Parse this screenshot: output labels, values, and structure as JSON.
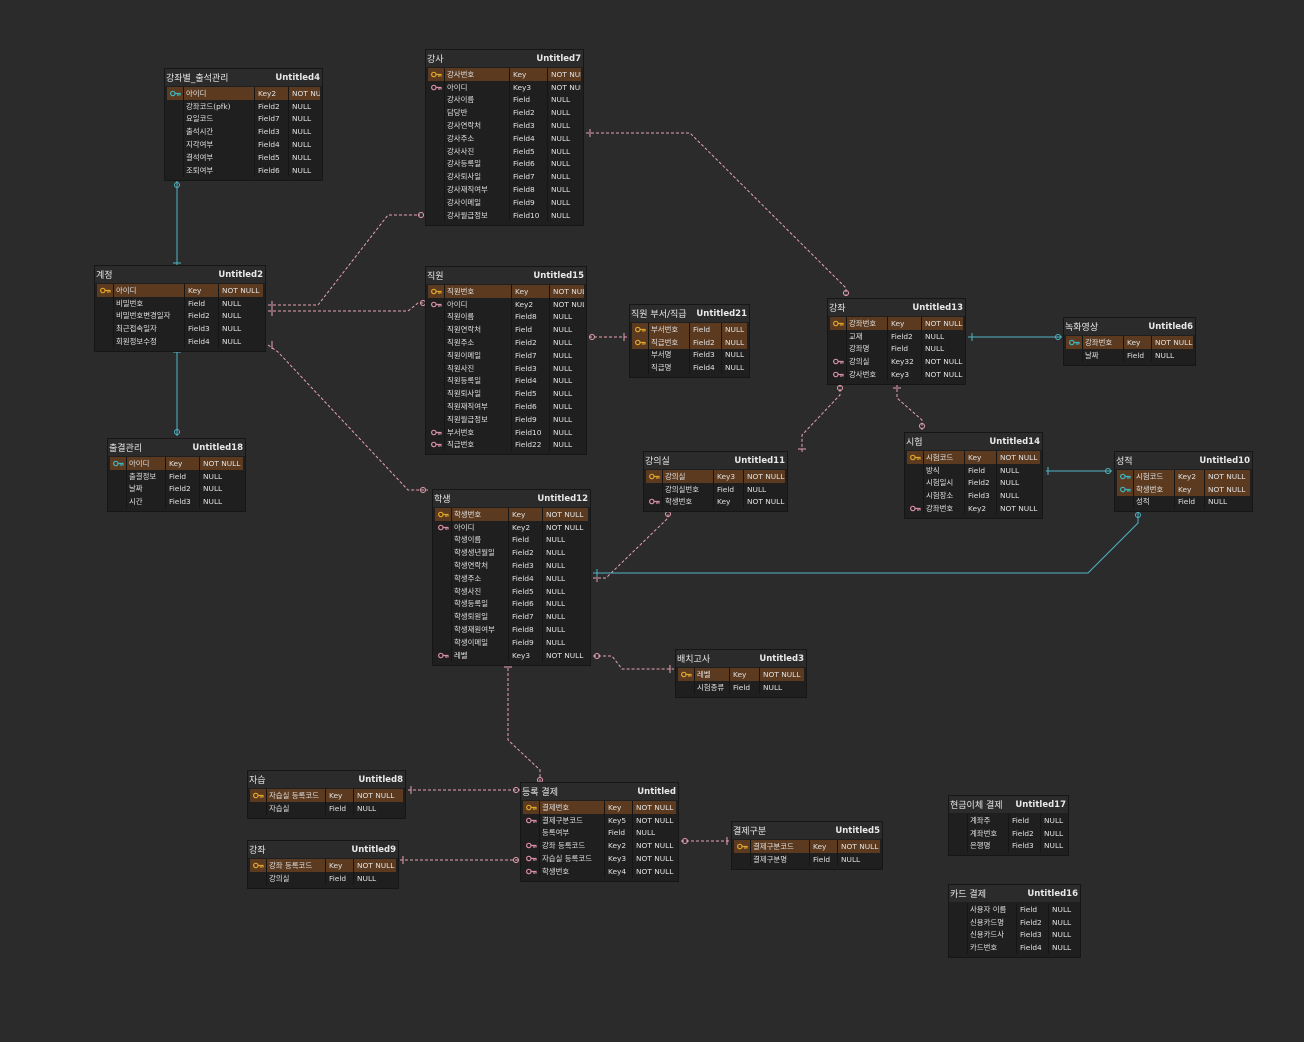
{
  "colors": {
    "background": "#2b2b2b",
    "table_body": "#1f1f1f",
    "selected_row": "#5b3a1f",
    "key_primary": "#e0a52a",
    "key_foreign": "#d98fa5",
    "key_cyan": "#39b7c4",
    "relation_pink": "#e8a3b3",
    "relation_cyan": "#4fb6c7"
  },
  "tables": [
    {
      "id": "t4",
      "name": "강좌별_출석관리",
      "tag": "Untitled4",
      "rows": [
        {
          "icon": "cyan",
          "n": "아이디",
          "t": "Key2",
          "v": "NOT NULL",
          "sel": true
        },
        {
          "icon": "",
          "n": "강좌코드(pfk)",
          "t": "Field2",
          "v": "NULL"
        },
        {
          "icon": "",
          "n": "요일코드",
          "t": "Field7",
          "v": "NULL"
        },
        {
          "icon": "",
          "n": "출석시간",
          "t": "Field3",
          "v": "NULL"
        },
        {
          "icon": "",
          "n": "지각여부",
          "t": "Field4",
          "v": "NULL"
        },
        {
          "icon": "",
          "n": "결석여부",
          "t": "Field5",
          "v": "NULL"
        },
        {
          "icon": "",
          "n": "조퇴여부",
          "t": "Field6",
          "v": "NULL"
        }
      ]
    },
    {
      "id": "t7",
      "name": "강사",
      "tag": "Untitled7",
      "rows": [
        {
          "icon": "pk",
          "n": "강사번호",
          "t": "Key",
          "v": "NOT NULL",
          "sel": true
        },
        {
          "icon": "fk",
          "n": "아이디",
          "t": "Key3",
          "v": "NOT NULL"
        },
        {
          "icon": "",
          "n": "강사이름",
          "t": "Field",
          "v": "NULL"
        },
        {
          "icon": "",
          "n": "담당반",
          "t": "Field2",
          "v": "NULL"
        },
        {
          "icon": "",
          "n": "강사연락처",
          "t": "Field3",
          "v": "NULL"
        },
        {
          "icon": "",
          "n": "강사주소",
          "t": "Field4",
          "v": "NULL"
        },
        {
          "icon": "",
          "n": "강사사진",
          "t": "Field5",
          "v": "NULL"
        },
        {
          "icon": "",
          "n": "강사등록일",
          "t": "Field6",
          "v": "NULL"
        },
        {
          "icon": "",
          "n": "강사퇴사일",
          "t": "Field7",
          "v": "NULL"
        },
        {
          "icon": "",
          "n": "강사재직여부",
          "t": "Field8",
          "v": "NULL"
        },
        {
          "icon": "",
          "n": "강사이메일",
          "t": "Field9",
          "v": "NULL"
        },
        {
          "icon": "",
          "n": "강사월급정보",
          "t": "Field10",
          "v": "NULL"
        }
      ]
    },
    {
      "id": "t2",
      "name": "계정",
      "tag": "Untitled2",
      "rows": [
        {
          "icon": "pk",
          "n": "아이디",
          "t": "Key",
          "v": "NOT NULL",
          "sel": true
        },
        {
          "icon": "",
          "n": "비밀번호",
          "t": "Field",
          "v": "NULL"
        },
        {
          "icon": "",
          "n": "비밀번호변경일자",
          "t": "Field2",
          "v": "NULL"
        },
        {
          "icon": "",
          "n": "최근접속일자",
          "t": "Field3",
          "v": "NULL"
        },
        {
          "icon": "",
          "n": "회원정보수정",
          "t": "Field4",
          "v": "NULL"
        }
      ]
    },
    {
      "id": "t15",
      "name": "직원",
      "tag": "Untitled15",
      "rows": [
        {
          "icon": "pk",
          "n": "직원번호",
          "t": "Key",
          "v": "NOT NULL",
          "sel": true
        },
        {
          "icon": "fk",
          "n": "아이디",
          "t": "Key2",
          "v": "NOT NULL"
        },
        {
          "icon": "",
          "n": "직원이름",
          "t": "Field8",
          "v": "NULL"
        },
        {
          "icon": "",
          "n": "직원연락처",
          "t": "Field",
          "v": "NULL"
        },
        {
          "icon": "",
          "n": "직원주소",
          "t": "Field2",
          "v": "NULL"
        },
        {
          "icon": "",
          "n": "직원이메일",
          "t": "Field7",
          "v": "NULL"
        },
        {
          "icon": "",
          "n": "직원사진",
          "t": "Field3",
          "v": "NULL"
        },
        {
          "icon": "",
          "n": "직원등록일",
          "t": "Field4",
          "v": "NULL"
        },
        {
          "icon": "",
          "n": "직원퇴사일",
          "t": "Field5",
          "v": "NULL"
        },
        {
          "icon": "",
          "n": "직원재직여부",
          "t": "Field6",
          "v": "NULL"
        },
        {
          "icon": "",
          "n": "직원월급정보",
          "t": "Field9",
          "v": "NULL"
        },
        {
          "icon": "fk",
          "n": "부서번호",
          "t": "Field10",
          "v": "NULL"
        },
        {
          "icon": "fk",
          "n": "직급번호",
          "t": "Field22",
          "v": "NULL"
        }
      ]
    },
    {
      "id": "t21",
      "name": "직원 부서/직급",
      "tag": "Untitled21",
      "rows": [
        {
          "icon": "pk",
          "n": "부서번호",
          "t": "Field",
          "v": "NULL",
          "sel": true
        },
        {
          "icon": "pk",
          "n": "직급번호",
          "t": "Field2",
          "v": "NULL",
          "sel": true
        },
        {
          "icon": "",
          "n": "부서명",
          "t": "Field3",
          "v": "NULL"
        },
        {
          "icon": "",
          "n": "직급명",
          "t": "Field4",
          "v": "NULL"
        }
      ]
    },
    {
      "id": "t13",
      "name": "강좌",
      "tag": "Untitled13",
      "rows": [
        {
          "icon": "pk",
          "n": "강좌번호",
          "t": "Key",
          "v": "NOT NULL",
          "sel": true
        },
        {
          "icon": "",
          "n": "교재",
          "t": "Field2",
          "v": "NULL"
        },
        {
          "icon": "",
          "n": "강좌명",
          "t": "Field",
          "v": "NULL"
        },
        {
          "icon": "fk",
          "n": "강의실",
          "t": "Key32",
          "v": "NOT NULL"
        },
        {
          "icon": "fk",
          "n": "강사번호",
          "t": "Key3",
          "v": "NOT NULL"
        }
      ]
    },
    {
      "id": "t6",
      "name": "녹화영상",
      "tag": "Untitled6",
      "rows": [
        {
          "icon": "cyan",
          "n": "강좌번호",
          "t": "Key",
          "v": "NOT NULL",
          "sel": true
        },
        {
          "icon": "",
          "n": "날짜",
          "t": "Field",
          "v": "NULL"
        }
      ]
    },
    {
      "id": "t18",
      "name": "출결관리",
      "tag": "Untitled18",
      "rows": [
        {
          "icon": "cyan",
          "n": "아이디",
          "t": "Key",
          "v": "NOT NULL",
          "sel": true
        },
        {
          "icon": "",
          "n": "출결정보",
          "t": "Field",
          "v": "NULL"
        },
        {
          "icon": "",
          "n": "날짜",
          "t": "Field2",
          "v": "NULL"
        },
        {
          "icon": "",
          "n": "시간",
          "t": "Field3",
          "v": "NULL"
        }
      ]
    },
    {
      "id": "t11",
      "name": "강의실",
      "tag": "Untitled11",
      "rows": [
        {
          "icon": "pk",
          "n": "강의실",
          "t": "Key3",
          "v": "NOT NULL",
          "sel": true
        },
        {
          "icon": "",
          "n": "강의실번호",
          "t": "Field",
          "v": "NULL"
        },
        {
          "icon": "fk",
          "n": "학생번호",
          "t": "Key",
          "v": "NOT NULL"
        }
      ]
    },
    {
      "id": "t14",
      "name": "시험",
      "tag": "Untitled14",
      "rows": [
        {
          "icon": "pk",
          "n": "시험코드",
          "t": "Key",
          "v": "NOT NULL",
          "sel": true
        },
        {
          "icon": "",
          "n": "방식",
          "t": "Field",
          "v": "NULL"
        },
        {
          "icon": "",
          "n": "시험일시",
          "t": "Field2",
          "v": "NULL"
        },
        {
          "icon": "",
          "n": "시험장소",
          "t": "Field3",
          "v": "NULL"
        },
        {
          "icon": "fk",
          "n": "강좌번호",
          "t": "Key2",
          "v": "NOT NULL"
        }
      ]
    },
    {
      "id": "t10",
      "name": "성적",
      "tag": "Untitled10",
      "rows": [
        {
          "icon": "cyan",
          "n": "시험코드",
          "t": "Key2",
          "v": "NOT NULL",
          "sel": true
        },
        {
          "icon": "cyan",
          "n": "학생번호",
          "t": "Key",
          "v": "NOT NULL",
          "sel": true
        },
        {
          "icon": "",
          "n": "성적",
          "t": "Field",
          "v": "NULL"
        }
      ]
    },
    {
      "id": "t12",
      "name": "학생",
      "tag": "Untitled12",
      "rows": [
        {
          "icon": "pk",
          "n": "학생번호",
          "t": "Key",
          "v": "NOT NULL",
          "sel": true
        },
        {
          "icon": "fk",
          "n": "아이디",
          "t": "Key2",
          "v": "NOT NULL"
        },
        {
          "icon": "",
          "n": "학생이름",
          "t": "Field",
          "v": "NULL"
        },
        {
          "icon": "",
          "n": "학생생년월일",
          "t": "Field2",
          "v": "NULL"
        },
        {
          "icon": "",
          "n": "학생연락처",
          "t": "Field3",
          "v": "NULL"
        },
        {
          "icon": "",
          "n": "학생주소",
          "t": "Field4",
          "v": "NULL"
        },
        {
          "icon": "",
          "n": "학생사진",
          "t": "Field5",
          "v": "NULL"
        },
        {
          "icon": "",
          "n": "학생등록일",
          "t": "Field6",
          "v": "NULL"
        },
        {
          "icon": "",
          "n": "학생퇴원일",
          "t": "Field7",
          "v": "NULL"
        },
        {
          "icon": "",
          "n": "학생재원여부",
          "t": "Field8",
          "v": "NULL"
        },
        {
          "icon": "",
          "n": "학생이메일",
          "t": "Field9",
          "v": "NULL"
        },
        {
          "icon": "fk",
          "n": "레벨",
          "t": "Key3",
          "v": "NOT NULL"
        }
      ]
    },
    {
      "id": "t3",
      "name": "배치고사",
      "tag": "Untitled3",
      "rows": [
        {
          "icon": "pk",
          "n": "레벨",
          "t": "Key",
          "v": "NOT NULL",
          "sel": true
        },
        {
          "icon": "",
          "n": "시험종류",
          "t": "Field",
          "v": "NULL"
        }
      ]
    },
    {
      "id": "t8",
      "name": "자습",
      "tag": "Untitled8",
      "rows": [
        {
          "icon": "pk",
          "n": "자습실 등록코드",
          "t": "Key",
          "v": "NOT NULL",
          "sel": true
        },
        {
          "icon": "",
          "n": "자습실",
          "t": "Field",
          "v": "NULL"
        }
      ]
    },
    {
      "id": "t0",
      "name": "등록 결제",
      "tag": "Untitled",
      "rows": [
        {
          "icon": "pk",
          "n": "결제번호",
          "t": "Key",
          "v": "NOT NULL",
          "sel": true
        },
        {
          "icon": "fk",
          "n": "결제구분코드",
          "t": "Key5",
          "v": "NOT NULL"
        },
        {
          "icon": "",
          "n": "등록여부",
          "t": "Field",
          "v": "NULL"
        },
        {
          "icon": "fk",
          "n": "강좌 등록코드",
          "t": "Key2",
          "v": "NOT NULL"
        },
        {
          "icon": "fk",
          "n": "자습실 등록코드",
          "t": "Key3",
          "v": "NOT NULL"
        },
        {
          "icon": "fk",
          "n": "학생번호",
          "t": "Key4",
          "v": "NOT NULL"
        }
      ]
    },
    {
      "id": "t5",
      "name": "결제구분",
      "tag": "Untitled5",
      "rows": [
        {
          "icon": "pk",
          "n": "결제구분코드",
          "t": "Key",
          "v": "NOT NULL",
          "sel": true
        },
        {
          "icon": "",
          "n": "결제구분명",
          "t": "Field",
          "v": "NULL"
        }
      ]
    },
    {
      "id": "t9",
      "name": "강좌",
      "tag": "Untitled9",
      "rows": [
        {
          "icon": "pk",
          "n": "강좌 등록코드",
          "t": "Key",
          "v": "NOT NULL",
          "sel": true
        },
        {
          "icon": "",
          "n": "강의실",
          "t": "Field",
          "v": "NULL"
        }
      ]
    },
    {
      "id": "t17",
      "name": "현금이체 결제",
      "tag": "Untitled17",
      "rows": [
        {
          "icon": "",
          "n": "계좌주",
          "t": "Field",
          "v": "NULL"
        },
        {
          "icon": "",
          "n": "계좌번호",
          "t": "Field2",
          "v": "NULL"
        },
        {
          "icon": "",
          "n": "은행명",
          "t": "Field3",
          "v": "NULL"
        }
      ]
    },
    {
      "id": "t16",
      "name": "카드 결제",
      "tag": "Untitled16",
      "rows": [
        {
          "icon": "",
          "n": "사용자 이름",
          "t": "Field",
          "v": "NULL"
        },
        {
          "icon": "",
          "n": "신용카드명",
          "t": "Field2",
          "v": "NULL"
        },
        {
          "icon": "",
          "n": "신용카드사",
          "t": "Field3",
          "v": "NULL"
        },
        {
          "icon": "",
          "n": "카드번호",
          "t": "Field4",
          "v": "NULL"
        }
      ]
    }
  ]
}
